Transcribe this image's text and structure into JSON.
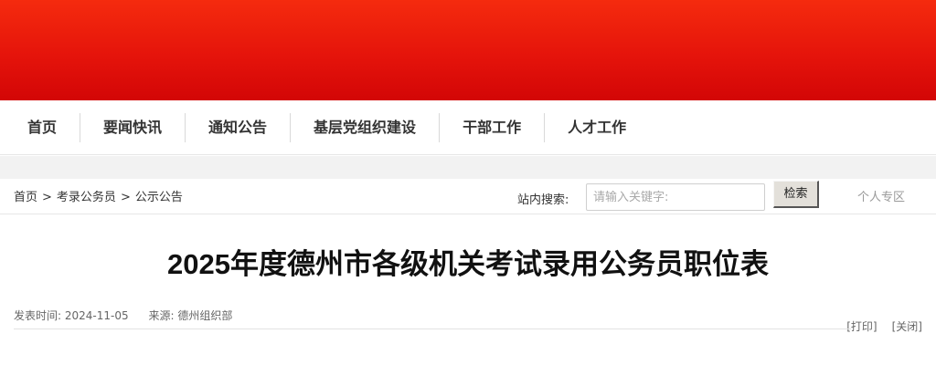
{
  "nav": {
    "items": [
      "首页",
      "要闻快讯",
      "通知公告",
      "基层党组织建设",
      "干部工作",
      "人才工作"
    ]
  },
  "breadcrumb": {
    "items": [
      "首页",
      "考录公务员",
      "公示公告"
    ],
    "separator": ">"
  },
  "search": {
    "label": "站内搜索:",
    "placeholder": "请输入关键字:",
    "button": "检索"
  },
  "personal_label": "个人专区",
  "article": {
    "title": "2025年度德州市各级机关考试录用公务员职位表",
    "publish_label": "发表时间:",
    "publish_date": "2024-11-05",
    "source_label": "来源:",
    "source": "德州组织部",
    "print_label": "[打印]",
    "close_label": "[关闭]"
  },
  "colors": {
    "banner": "#e5140b",
    "nav_text": "#333333",
    "title_text": "#111111"
  }
}
